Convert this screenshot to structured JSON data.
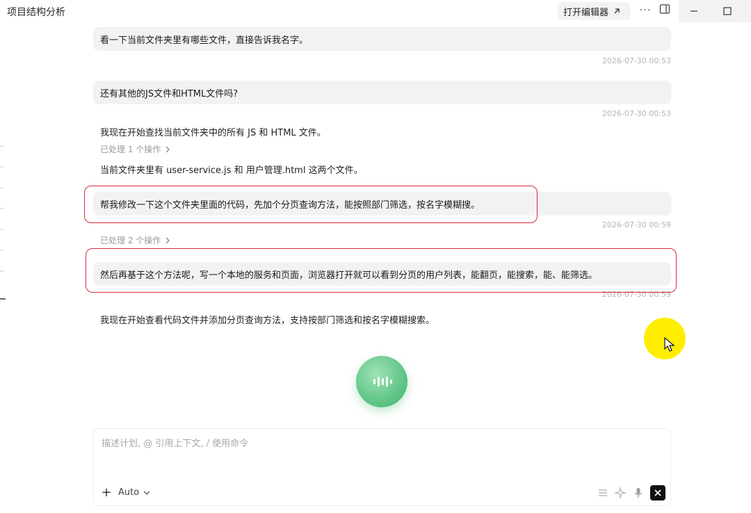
{
  "window": {
    "title": "项目结构分析",
    "open_editor_label": "打开编辑器",
    "more_icon": "more-horizontal-icon",
    "panel_icon": "panel-toggle-icon"
  },
  "messages": [
    {
      "role": "user",
      "text": "看一下当前文件夹里有哪些文件，直接告诉我名字。",
      "timestamp": "2026-07-30 00:53"
    },
    {
      "role": "user",
      "text": "还有其他的JS文件和HTML文件吗?",
      "timestamp": "2026-07-30 00:53"
    },
    {
      "role": "assistant",
      "text": "我现在开始查找当前文件夹中的所有 JS 和 HTML 文件。"
    },
    {
      "role": "processed",
      "text": "已处理 1 个操作"
    },
    {
      "role": "assistant",
      "text": "当前文件夹里有 user-service.js 和 用户管理.html 这两个文件。"
    },
    {
      "role": "user",
      "text": "帮我修改一下这个文件夹里面的代码，先加个分页查询方法，能按照部门筛选，按名字模糊搜。",
      "timestamp": "2026-07-30 00:59"
    },
    {
      "role": "processed",
      "text": "已处理 2 个操作"
    },
    {
      "role": "user",
      "text": "然后再基于这个方法呢，写一个本地的服务和页面，浏览器打开就可以看到分页的用户列表，能翻页，能搜索，能、能筛选。",
      "timestamp": "2026-07-30 00:59"
    },
    {
      "role": "assistant",
      "text": "我现在开始查看代码文件并添加分页查询方法，支持按部门筛选和按名字模糊搜索。"
    }
  ],
  "composer": {
    "placeholder": "描述计划, @ 引用上下文, / 使用命令",
    "model": "Auto"
  }
}
